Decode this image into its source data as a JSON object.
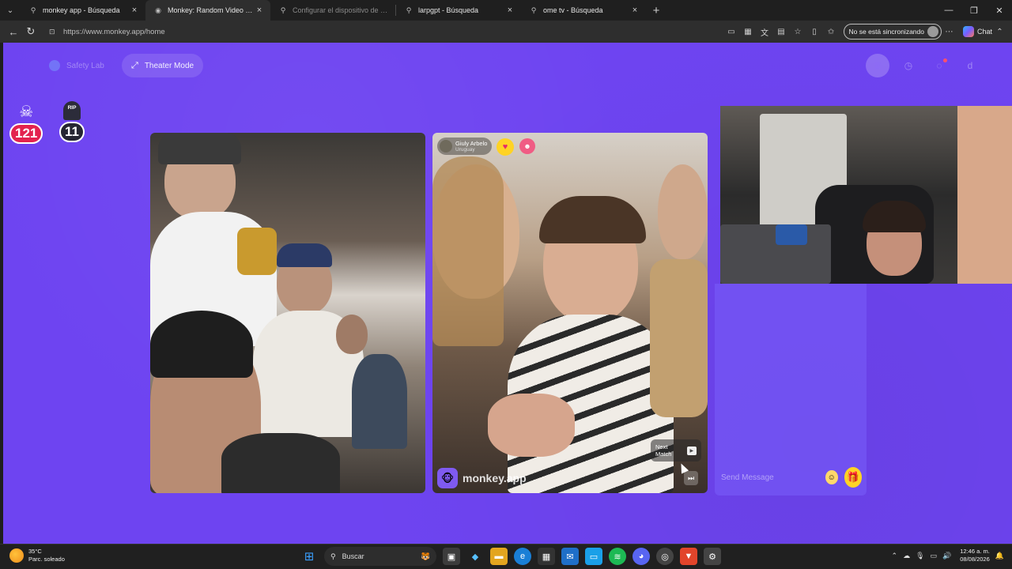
{
  "browser": {
    "tabs": [
      {
        "title": "monkey app - Búsqueda",
        "icon": "search-icon",
        "active": false,
        "dim": false
      },
      {
        "title": "Monkey: Random Video Chat",
        "icon": "monkey-favicon",
        "active": true,
        "dim": false
      },
      {
        "title": "Configurar el dispositivo de audio",
        "icon": "search-icon",
        "active": false,
        "dim": true
      },
      {
        "title": "larpgpt - Búsqueda",
        "icon": "search-icon",
        "active": false,
        "dim": false
      },
      {
        "title": "ome tv - Búsqueda",
        "icon": "search-icon",
        "active": false,
        "dim": false
      }
    ],
    "url": "https://www.monkey.app/home",
    "sync_label": "No se está sincronizando",
    "copilot_label": "Chat"
  },
  "page": {
    "safety_lab": "Safety Lab",
    "theater_mode": "Theater Mode",
    "stats": {
      "skull_count": "121",
      "rip_label": "RIP",
      "rip_count": "11"
    },
    "match": {
      "name": "Giuly Arbelo",
      "country": "Uruguay",
      "brand": "monkey.app",
      "next_match": "Next Match"
    },
    "chat": {
      "placeholder": "Send Message"
    }
  },
  "taskbar": {
    "temperature": "35°C",
    "weather": "Parc. soleado",
    "search_label": "Buscar",
    "time": "12:46 a. m.",
    "date": "08/08/2026"
  },
  "colors": {
    "page_bg": "#6e44f1",
    "accent_yellow": "#ffd324",
    "skull_badge": "#e3234f"
  }
}
